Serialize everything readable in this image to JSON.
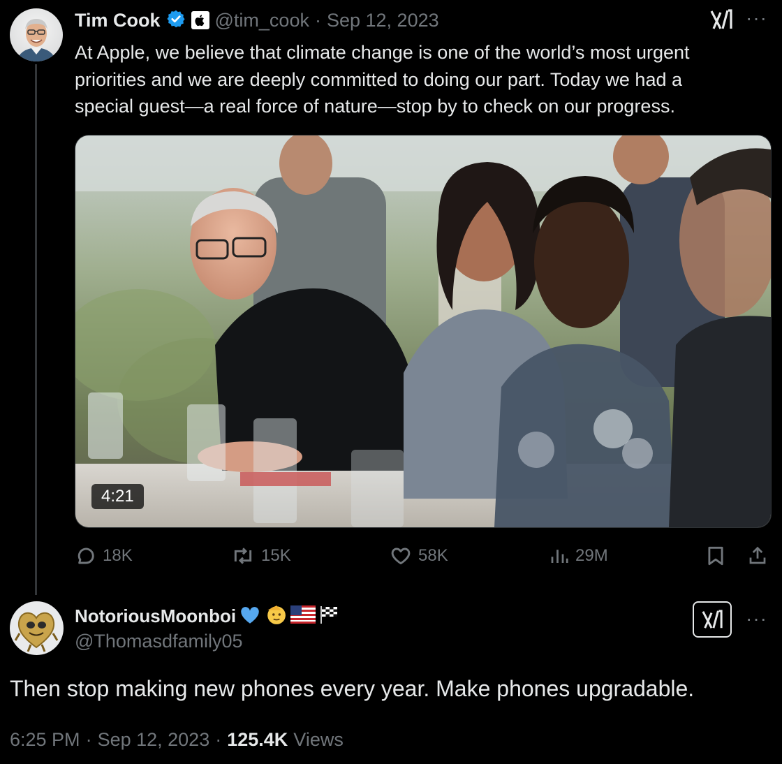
{
  "original_tweet": {
    "author_name": "Tim Cook",
    "handle": "@tim_cook",
    "separator": "·",
    "date": "Sep 12, 2023",
    "text_lines": [
      "At Apple, we believe that climate change is one of the world’s most urgent",
      "priorities and we are deeply committed to doing our part. Today we had a",
      "special guest—a real force of nature—stop by to check on our progress."
    ],
    "video_duration": "4:21",
    "stats": {
      "replies": "18K",
      "reposts": "15K",
      "likes": "58K",
      "views": "29M"
    }
  },
  "reply_tweet": {
    "author_name": "NotoriousMoonboi",
    "handle": "@Thomasdfamily05",
    "text": "Then stop making new phones every year. Make phones upgradable.",
    "time": "6:25 PM",
    "separator": "·",
    "date": "Sep 12, 2023",
    "separator2": "·",
    "views_count": "125.4K",
    "views_label": "Views"
  },
  "icons": {
    "verified": "verified-badge-icon",
    "apple": "apple-affiliate-icon",
    "grok": "grok-icon",
    "more": "more-dots-icon",
    "reply": "reply-icon",
    "repost": "repost-icon",
    "like": "heart-icon",
    "views": "views-icon",
    "bookmark": "bookmark-icon",
    "share": "share-icon"
  },
  "colors": {
    "background": "#000000",
    "text_primary": "#e7e9ea",
    "text_secondary": "#71767b",
    "verified_blue": "#1d9bf0"
  }
}
